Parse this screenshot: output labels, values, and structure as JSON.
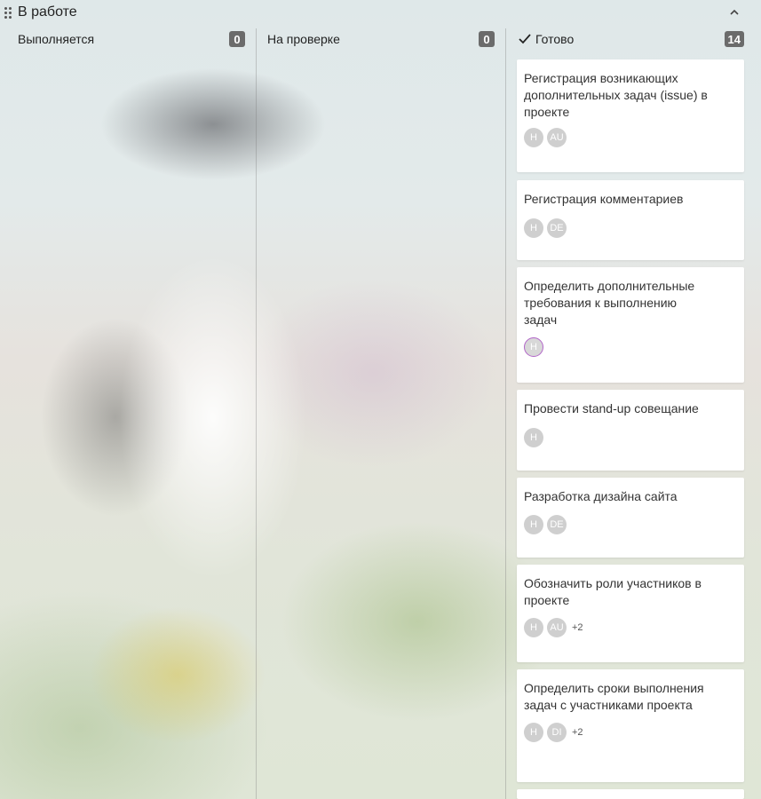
{
  "group": {
    "title": "В работе",
    "drag_icon": "drag-handle-icon",
    "collapse_icon": "chevron-up-icon"
  },
  "columns": [
    {
      "title": "Выполняется",
      "count": "0"
    },
    {
      "title": "На проверке",
      "count": "0"
    },
    {
      "title": "Готово",
      "count": "14",
      "icon": "check-icon"
    }
  ],
  "done_cards": [
    {
      "title": "Регистрация возникающих дополнительных задач (issue) в проекте",
      "assignees": [
        "H",
        "AU"
      ],
      "more": ""
    },
    {
      "title": "Регистрация комментариев",
      "assignees": [
        "H",
        "DE"
      ],
      "more": ""
    },
    {
      "title": "Определить дополнительные требования к выполнению задач",
      "assignees": [
        "H"
      ],
      "more": ""
    },
    {
      "title": "Провести stand-up совещание",
      "assignees": [
        "H"
      ],
      "more": ""
    },
    {
      "title": "Разработка дизайна сайта",
      "assignees": [
        "H",
        "DE"
      ],
      "more": ""
    },
    {
      "title": "Обозначить роли участников в проекте",
      "assignees": [
        "H",
        "AU"
      ],
      "more": "+2"
    },
    {
      "title": "Определить сроки выполнения задач с участниками проекта",
      "assignees": [
        "H",
        "DI"
      ],
      "more": "+2"
    }
  ]
}
